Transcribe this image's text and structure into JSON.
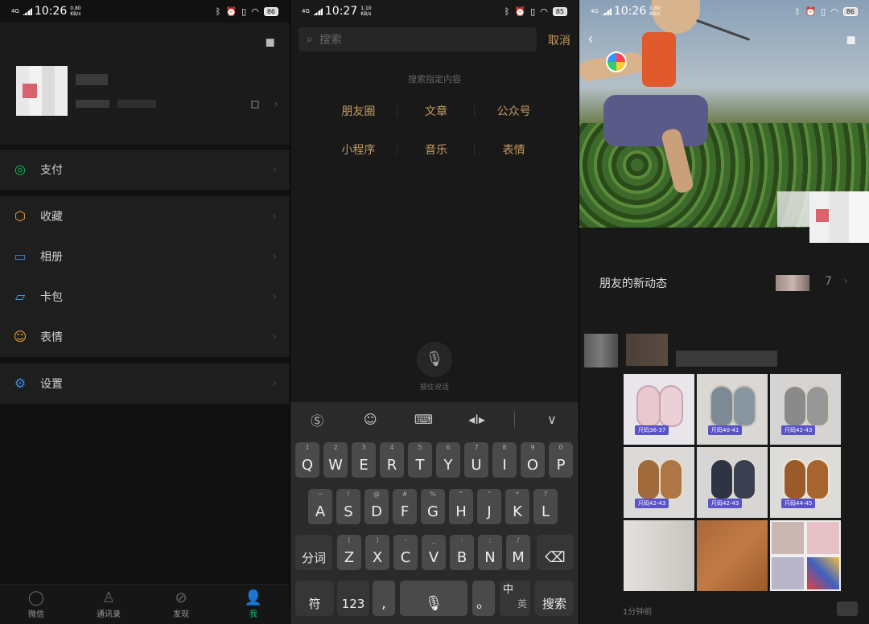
{
  "panel1": {
    "status": {
      "net": "4G",
      "time": "10:26",
      "speed_top": "0.80",
      "speed_bottom": "KB/s",
      "battery": "86"
    },
    "menu": [
      {
        "label": "支付",
        "icon": "wechat-pay-icon",
        "color": "#07c160"
      },
      {
        "label": "收藏",
        "icon": "favorites-cube-icon",
        "color": "#f0a030"
      },
      {
        "label": "相册",
        "icon": "album-icon",
        "color": "#3a8be0"
      },
      {
        "label": "卡包",
        "icon": "card-wallet-icon",
        "color": "#3a8be0"
      },
      {
        "label": "表情",
        "icon": "sticker-smile-icon",
        "color": "#f0a030"
      },
      {
        "label": "设置",
        "icon": "settings-gear-icon",
        "color": "#3a8be0"
      }
    ],
    "tabs": [
      {
        "label": "微信",
        "icon": "chat-icon",
        "active": false
      },
      {
        "label": "通讯录",
        "icon": "contacts-icon",
        "active": false
      },
      {
        "label": "发现",
        "icon": "discover-compass-icon",
        "active": false
      },
      {
        "label": "我",
        "icon": "me-person-icon",
        "active": true
      }
    ]
  },
  "panel2": {
    "status": {
      "net": "4G",
      "time": "10:27",
      "speed_top": "1.10",
      "speed_bottom": "KB/s",
      "battery": "85"
    },
    "search": {
      "placeholder": "搜索",
      "cancel": "取消"
    },
    "hint": "搜索指定内容",
    "categories": [
      "朋友圈",
      "文章",
      "公众号",
      "小程序",
      "音乐",
      "表情"
    ],
    "voice_label": "按住说话",
    "keyboard": {
      "row1": [
        [
          "1",
          "Q"
        ],
        [
          "2",
          "W"
        ],
        [
          "3",
          "E"
        ],
        [
          "4",
          "R"
        ],
        [
          "5",
          "T"
        ],
        [
          "6",
          "Y"
        ],
        [
          "7",
          "U"
        ],
        [
          "8",
          "I"
        ],
        [
          "9",
          "O"
        ],
        [
          "0",
          "P"
        ]
      ],
      "row2": [
        [
          "~",
          "A"
        ],
        [
          "!",
          "S"
        ],
        [
          "@",
          "D"
        ],
        [
          "#",
          "F"
        ],
        [
          "%",
          "G"
        ],
        [
          "“",
          "H"
        ],
        [
          "”",
          "J"
        ],
        [
          "*",
          "K"
        ],
        [
          "?",
          "L"
        ]
      ],
      "row3": [
        [
          "(",
          "Z"
        ],
        [
          ")",
          "X"
        ],
        [
          "-",
          "C"
        ],
        [
          "_",
          "V"
        ],
        [
          ":",
          "B"
        ],
        [
          ";",
          "N"
        ],
        [
          "/",
          "M"
        ]
      ],
      "row3_left": "分词",
      "bottom": {
        "symbol": "符",
        "num": "123",
        "comma": ",",
        "period": "。",
        "lang_top": "中",
        "lang_bottom": "英",
        "search": "搜索"
      }
    }
  },
  "panel3": {
    "status": {
      "net": "4G",
      "time": "10:26",
      "speed_top": "0.60",
      "speed_bottom": "KB/s",
      "battery": "86"
    },
    "friend_news": "朋友的新动态",
    "news_count": "7",
    "sizes": [
      "尺码36-37",
      "尺码40-41",
      "尺码42-43",
      "尺码42-43",
      "尺码42-43",
      "尺码44-45"
    ],
    "time_ago": "1分钟前"
  }
}
